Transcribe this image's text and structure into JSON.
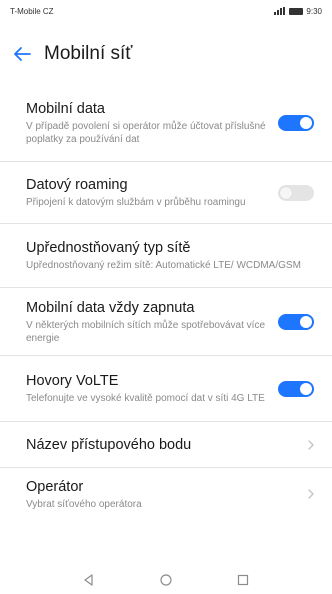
{
  "status_bar": {
    "carrier": "T-Mobile CZ",
    "time": "9:30"
  },
  "header": {
    "title": "Mobilní síť"
  },
  "settings": [
    {
      "title": "Mobilní data",
      "subtitle": "V případě povolení si operátor může účtovat příslušné poplatky za používání dat",
      "control": "toggle",
      "state": "on"
    },
    {
      "title": "Datový roaming",
      "subtitle": "Připojení k datovým službám v průběhu roamingu",
      "control": "toggle",
      "state": "off"
    },
    {
      "title": "Upřednostňovaný typ sítě",
      "subtitle": "Upřednostňovaný režim sítě: Automatické LTE/ WCDMA/GSM",
      "control": "none"
    },
    {
      "title": "Mobilní data vždy zapnuta",
      "subtitle": "V některých mobilních sítích může spotřebovávat více energie",
      "control": "toggle",
      "state": "on"
    },
    {
      "title": "Hovory VoLTE",
      "subtitle": "Telefonujte ve vysoké kvalitě pomocí dat v síti 4G LTE",
      "control": "toggle",
      "state": "on"
    },
    {
      "title": "Název přístupového bodu",
      "subtitle": "",
      "control": "chevron"
    },
    {
      "title": "Operátor",
      "subtitle": "Vybrat síťového operátora",
      "control": "chevron"
    }
  ],
  "colors": {
    "accent": "#1e76ff",
    "toggle_off": "#e4e4e4",
    "subtitle": "#8a8a8a"
  },
  "icons": {
    "back": "arrow-left-icon",
    "chevron": "chevron-right-icon",
    "nav_back": "triangle-back-icon",
    "nav_home": "circle-home-icon",
    "nav_recent": "square-recent-icon"
  }
}
